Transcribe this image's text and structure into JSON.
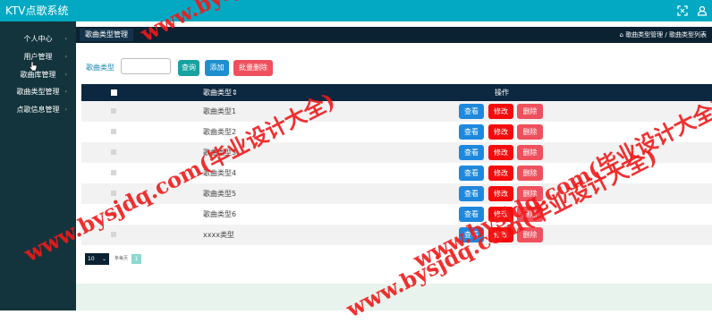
{
  "app": {
    "title": "KTV点歌系统"
  },
  "topbar": {
    "icons": [
      "expand-icon",
      "user-icon"
    ]
  },
  "sidebar": {
    "items": [
      {
        "label": "个人中心"
      },
      {
        "label": "用户管理"
      },
      {
        "label": "歌曲库管理"
      },
      {
        "label": "歌曲类型管理"
      },
      {
        "label": "点歌信息管理"
      }
    ]
  },
  "header": {
    "active_tab": "歌曲类型管理",
    "breadcrumb": "歌曲类型管理 / 歌曲类型列表"
  },
  "search": {
    "label": "歌曲类型",
    "value": "",
    "query_button": "查询",
    "add_button": "添加",
    "batch_delete_button": "批量删除"
  },
  "table": {
    "columns": [
      "",
      "歌曲类型",
      "操作"
    ],
    "sort_mark": "⇕",
    "rows": [
      {
        "name": "歌曲类型1"
      },
      {
        "name": "歌曲类型2"
      },
      {
        "name": "歌曲类型3"
      },
      {
        "name": "歌曲类型4"
      },
      {
        "name": "歌曲类型5"
      },
      {
        "name": "歌曲类型6"
      },
      {
        "name": "xxxx类型"
      }
    ],
    "row_actions": {
      "view": "查看",
      "edit": "修改",
      "delete": "删除"
    }
  },
  "pagination": {
    "page_size": "10",
    "per_page_label": "条每页",
    "current_page": "1"
  },
  "watermark": {
    "text": "www.bysjdq.com(毕业设计大全)"
  },
  "colors": {
    "topbar": "#03a9c3",
    "sidebar": "#13343c",
    "header": "#0b2233",
    "table_head": "#0c2740",
    "query": "#17a2a0",
    "add": "#1c8fce",
    "batch_delete": "#f0505d",
    "view": "#1e88dd",
    "edit": "#f40c0c",
    "delete": "#f0505d",
    "watermark": "#f01a1a"
  }
}
